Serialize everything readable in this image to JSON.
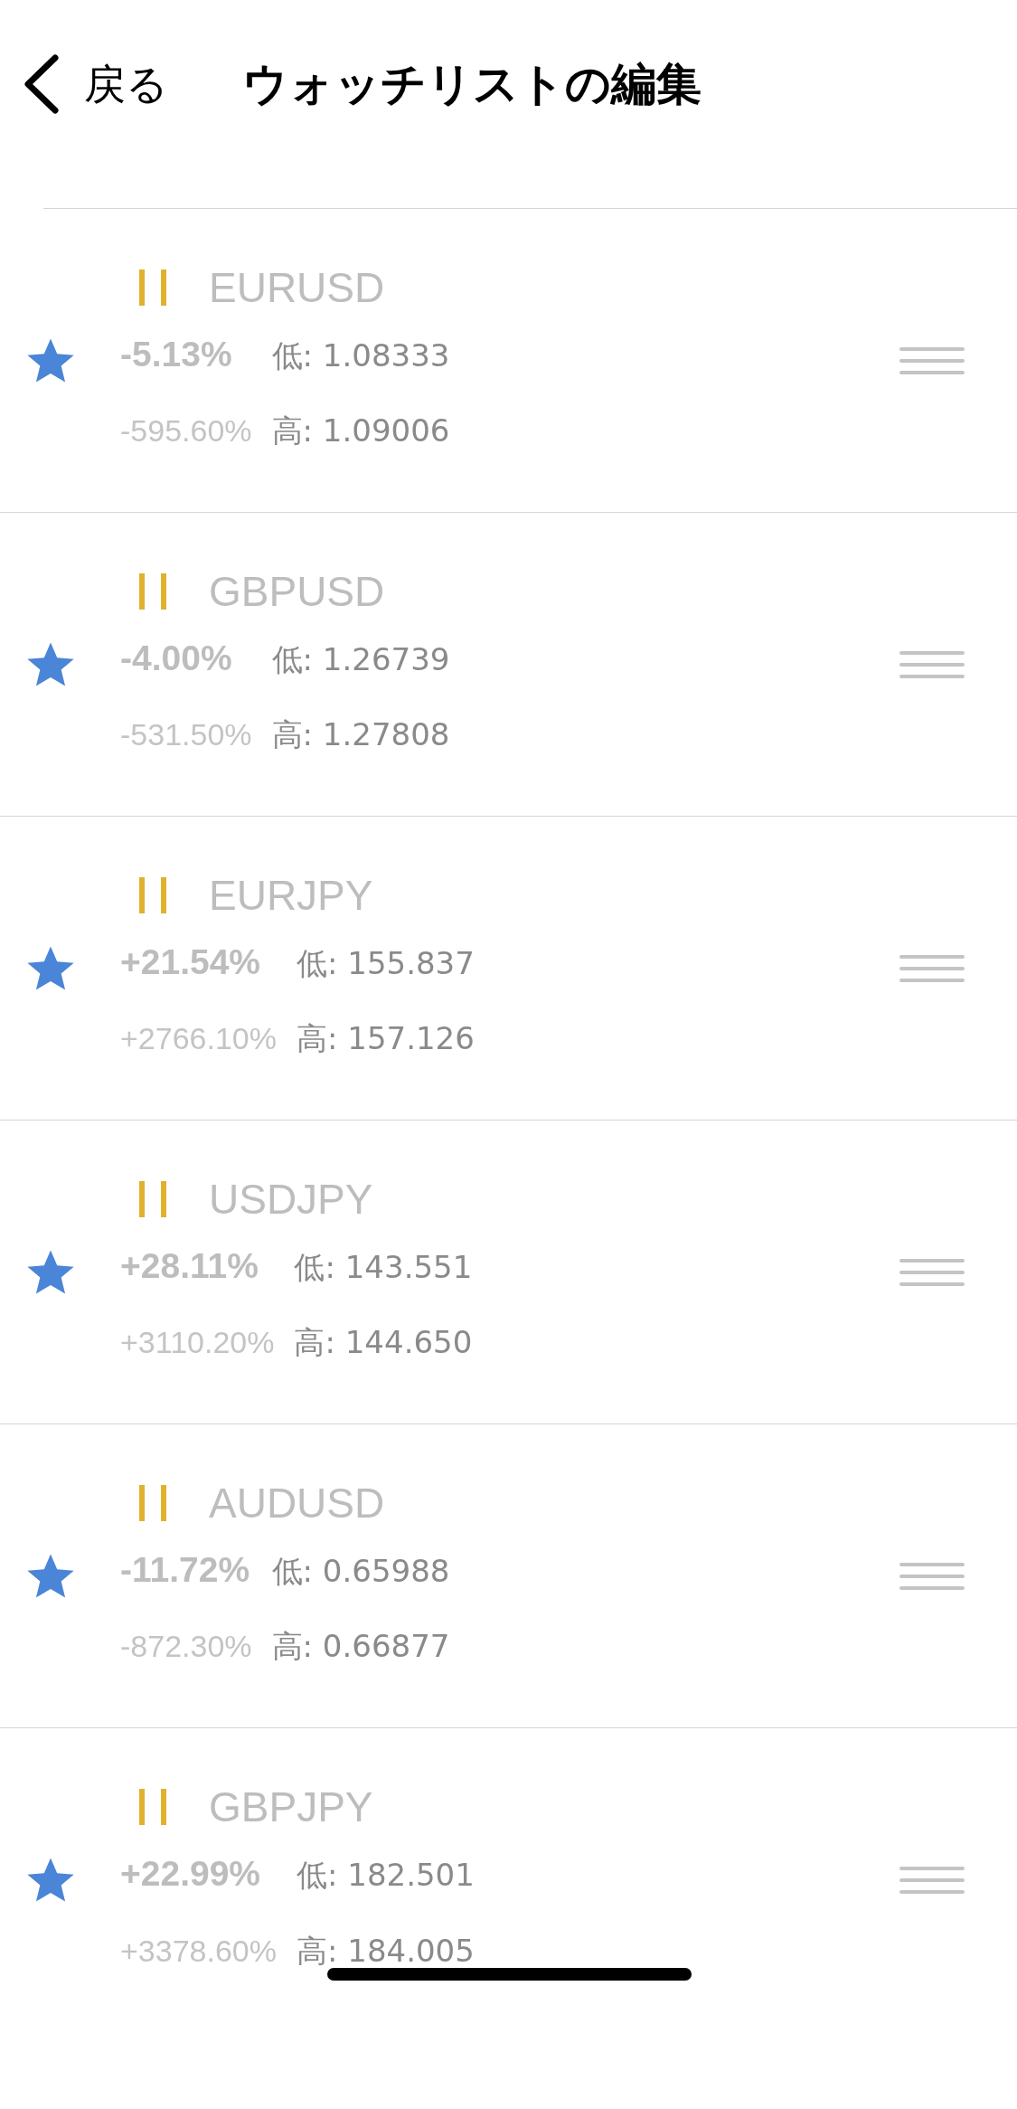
{
  "header": {
    "back_label": "戻る",
    "title": "ウォッチリストの編集"
  },
  "items": [
    {
      "symbol": "EURUSD",
      "starred": true,
      "change": "-5.13%",
      "change_points": "-595.60%",
      "low": "低: 1.08333",
      "high": "高: 1.09006"
    },
    {
      "symbol": "GBPUSD",
      "starred": true,
      "change": "-4.00%",
      "change_points": "-531.50%",
      "low": "低: 1.26739",
      "high": "高: 1.27808"
    },
    {
      "symbol": "EURJPY",
      "starred": true,
      "change": "+21.54%",
      "change_points": "+2766.10%",
      "low": "低: 155.837",
      "high": "高: 157.126"
    },
    {
      "symbol": "USDJPY",
      "starred": true,
      "change": "+28.11%",
      "change_points": "+3110.20%",
      "low": "低: 143.551",
      "high": "高: 144.650"
    },
    {
      "symbol": "AUDUSD",
      "starred": true,
      "change": "-11.72%",
      "change_points": "-872.30%",
      "low": "低: 0.65988",
      "high": "高: 0.66877"
    },
    {
      "symbol": "GBPJPY",
      "starred": true,
      "change": "+22.99%",
      "change_points": "+3378.60%",
      "low": "低: 182.501",
      "high": "高: 184.005"
    }
  ]
}
